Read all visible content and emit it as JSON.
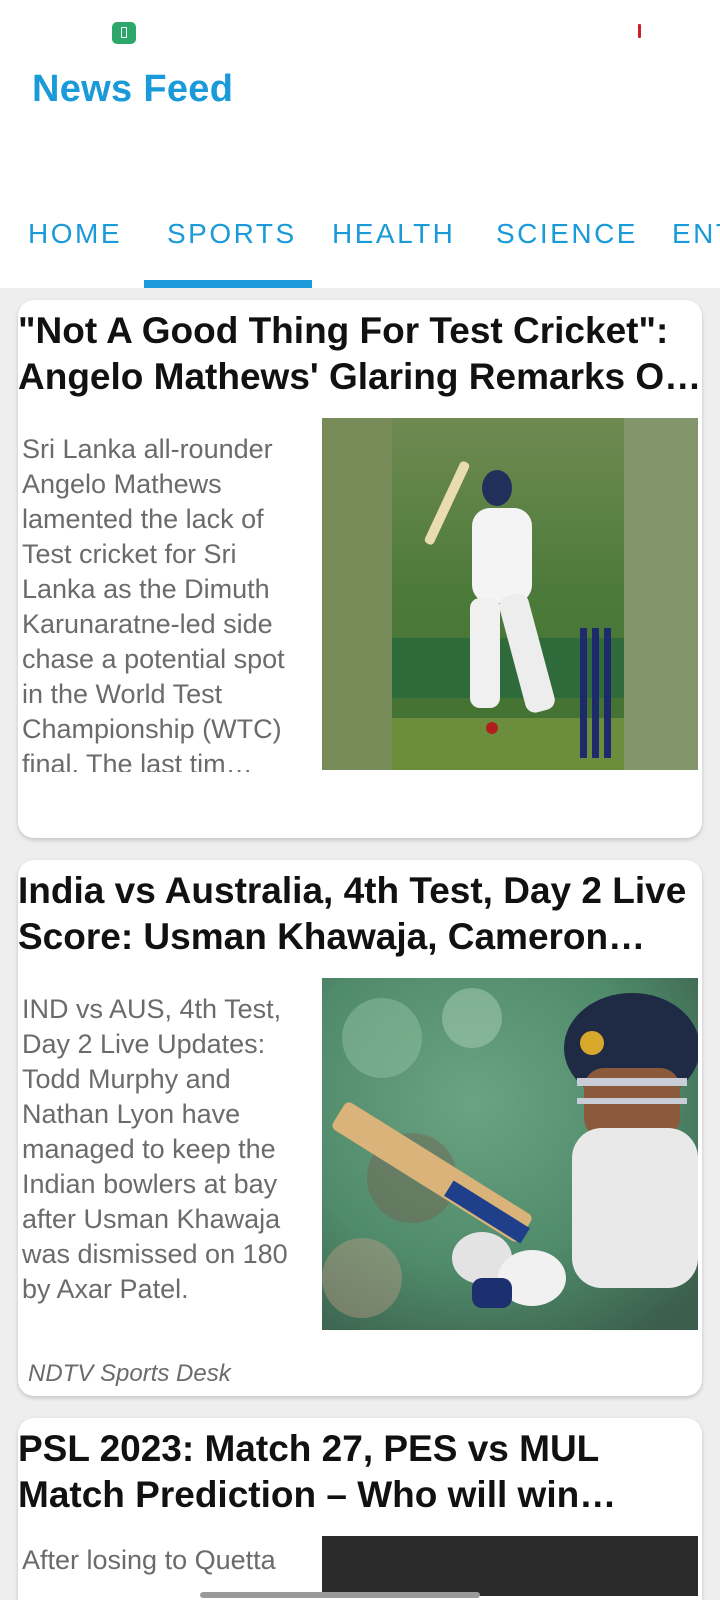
{
  "app": {
    "title": "News Feed"
  },
  "tabs": [
    {
      "label": "HOME"
    },
    {
      "label": "SPORTS",
      "selected": true
    },
    {
      "label": "HEALTH"
    },
    {
      "label": "SCIENCE"
    },
    {
      "label": "ENTERTAINMENT"
    }
  ],
  "articles": [
    {
      "title": "\"Not A Good Thing For Test Cricket\": Angelo Mathews' Glaring Remarks On Sri Lanka's Test Schedule",
      "description": "Sri Lanka all-rounder Angelo Mathews lamented the lack of Test cricket for Sri Lanka as the Dimuth Karunaratne-led side chase a potential spot in the World Test Championship (WTC) final. The last tim…",
      "author": "",
      "image": "cricket-batsman-photo"
    },
    {
      "title": "India vs Australia, 4th Test, Day 2 Live Score: Usman Khawaja, Cameron Green",
      "description": "IND vs AUS, 4th Test, Day 2 Live Updates: Todd Murphy and Nathan Lyon have managed to keep the Indian bowlers at bay after Usman Khawaja was dismissed on 180 by Axar Patel.",
      "author": "NDTV Sports Desk",
      "image": "india-batsman-photo"
    },
    {
      "title": "PSL 2023: Match 27, PES vs MUL Match Prediction – Who will win today's PSL match?",
      "description": "After losing to Quetta",
      "author": "",
      "image": "psl-match-photo"
    }
  ],
  "colors": {
    "accent": "#1a9ad9",
    "feed_background": "#eeeeee",
    "title_text": "#111111",
    "body_text": "#6b6b6b"
  }
}
